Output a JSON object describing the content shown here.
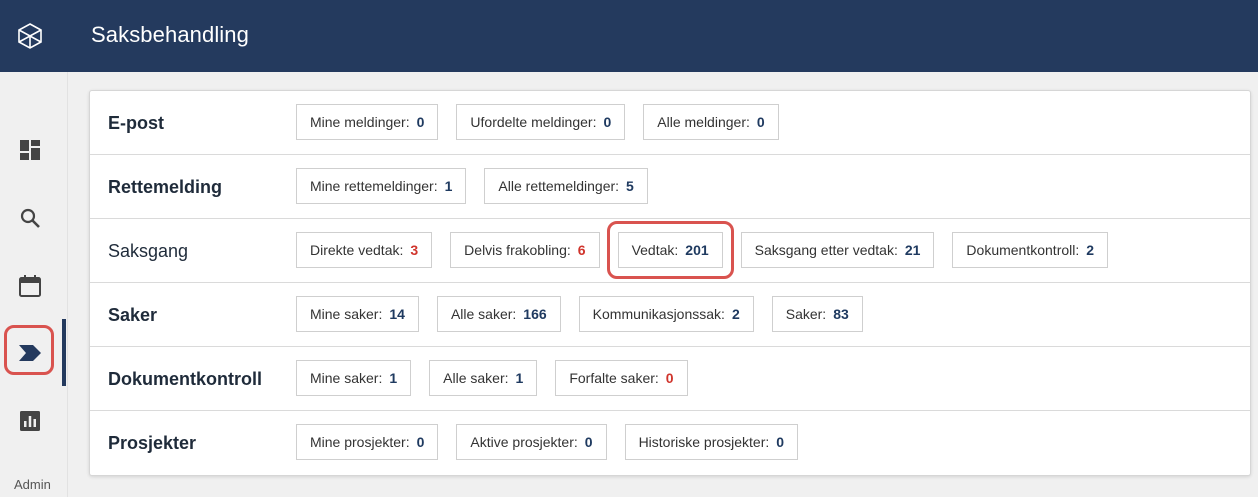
{
  "header": {
    "title": "Saksbehandling",
    "logo_icon": "hexagon-logo-icon",
    "bg_color": "#243a5e"
  },
  "sidebar": {
    "items": [
      {
        "name": "dashboard-icon"
      },
      {
        "name": "search-icon"
      },
      {
        "name": "calendar-icon"
      },
      {
        "name": "chevron-right-icon",
        "active": true
      },
      {
        "name": "bar-chart-icon"
      }
    ],
    "admin_label": "Admin"
  },
  "colors": {
    "accent": "#243a5e",
    "highlight": "#d9534f",
    "count_red": "#d0342c",
    "count_default": "#1f3a60"
  },
  "sections": [
    {
      "label": "E-post",
      "chips": [
        {
          "label": "Mine meldinger:",
          "count": "0"
        },
        {
          "label": "Ufordelte meldinger:",
          "count": "0"
        },
        {
          "label": "Alle meldinger:",
          "count": "0"
        }
      ]
    },
    {
      "label": "Rettemelding",
      "chips": [
        {
          "label": "Mine rettemeldinger:",
          "count": "1"
        },
        {
          "label": "Alle rettemeldinger:",
          "count": "5"
        }
      ]
    },
    {
      "label": "Saksgang",
      "chips": [
        {
          "label": "Direkte vedtak:",
          "count": "3"
        },
        {
          "label": "Delvis frakobling:",
          "count": "6"
        },
        {
          "label": "Vedtak:",
          "count": "201"
        },
        {
          "label": "Saksgang etter vedtak:",
          "count": "21"
        },
        {
          "label": "Dokumentkontroll:",
          "count": "2"
        }
      ]
    },
    {
      "label": "Saker",
      "chips": [
        {
          "label": "Mine saker:",
          "count": "14"
        },
        {
          "label": "Alle saker:",
          "count": "166"
        },
        {
          "label": "Kommunikasjonssak:",
          "count": "2"
        },
        {
          "label": "Saker:",
          "count": "83"
        }
      ]
    },
    {
      "label": "Dokumentkontroll",
      "chips": [
        {
          "label": "Mine saker:",
          "count": "1"
        },
        {
          "label": "Alle saker:",
          "count": "1"
        },
        {
          "label": "Forfalte saker:",
          "count": "0"
        }
      ]
    },
    {
      "label": "Prosjekter",
      "chips": [
        {
          "label": "Mine prosjekter:",
          "count": "0"
        },
        {
          "label": "Aktive prosjekter:",
          "count": "0"
        },
        {
          "label": "Historiske prosjekter:",
          "count": "0"
        }
      ]
    }
  ]
}
